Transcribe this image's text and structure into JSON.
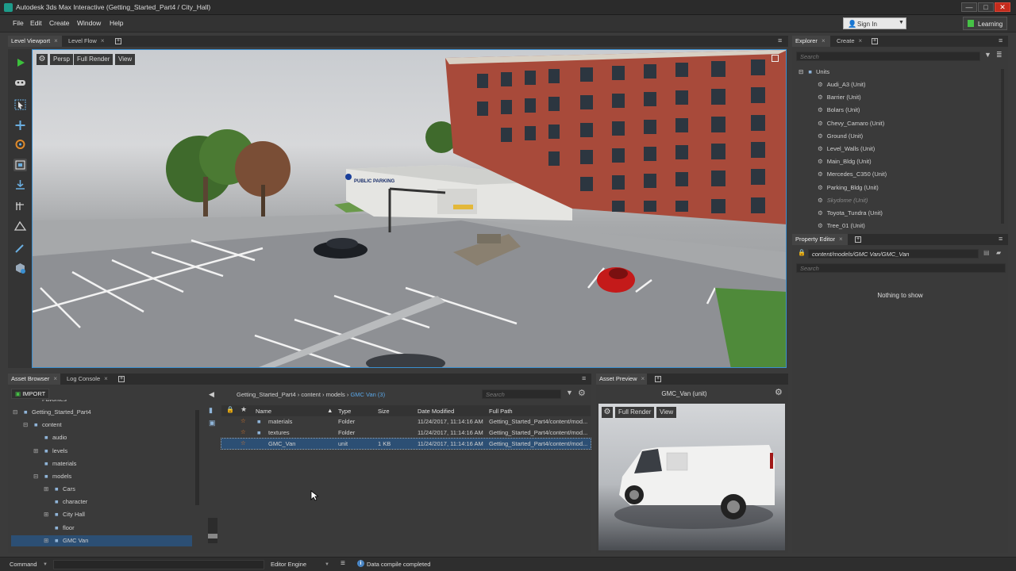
{
  "window": {
    "title": "Autodesk 3ds Max Interactive (Getting_Started_Part4 / City_Hall)",
    "minimize": "—",
    "maximize": "□",
    "close": "✕"
  },
  "menu": [
    "File",
    "Edit",
    "Create",
    "Window",
    "Help"
  ],
  "header": {
    "sign_in": "Sign In",
    "learning": "Learning"
  },
  "viewport_tabs": [
    "Level Viewport",
    "Level Flow"
  ],
  "viewport": {
    "persp": "Persp",
    "full_render": "Full Render",
    "view": "View",
    "sign_text": "PUBLIC PARKING"
  },
  "explorer": {
    "tabs": [
      "Explorer",
      "Create"
    ],
    "search_placeholder": "Search",
    "root": "Units",
    "items": [
      {
        "label": "Audi_A3 (Unit)",
        "dim": false
      },
      {
        "label": "Barrier (Unit)",
        "dim": false
      },
      {
        "label": "Bolars (Unit)",
        "dim": false
      },
      {
        "label": "Chevy_Camaro (Unit)",
        "dim": false
      },
      {
        "label": "Ground (Unit)",
        "dim": false
      },
      {
        "label": "Level_Walls (Unit)",
        "dim": false
      },
      {
        "label": "Main_Bldg (Unit)",
        "dim": false
      },
      {
        "label": "Mercedes_C350 (Unit)",
        "dim": false
      },
      {
        "label": "Parking_Bldg (Unit)",
        "dim": false
      },
      {
        "label": "Skydome (Unit)",
        "dim": true
      },
      {
        "label": "Toyota_Tundra (Unit)",
        "dim": false
      },
      {
        "label": "Tree_01 (Unit)",
        "dim": false
      }
    ]
  },
  "property_editor": {
    "tab": "Property Editor",
    "path": "content/models/GMC Van/GMC_Van",
    "search_placeholder": "Search",
    "empty": "Nothing to show"
  },
  "asset_browser": {
    "tabs": [
      "Asset Browser",
      "Log Console"
    ],
    "import": "IMPORT",
    "tree": [
      {
        "label": "Favorites",
        "indent": 1,
        "expander": "",
        "folder": false,
        "selected": false
      },
      {
        "label": "Getting_Started_Part4",
        "indent": 0,
        "expander": "⊟",
        "folder": true,
        "selected": false
      },
      {
        "label": "content",
        "indent": 1,
        "expander": "⊟",
        "folder": true,
        "selected": false
      },
      {
        "label": "audio",
        "indent": 2,
        "expander": "",
        "folder": true,
        "selected": false
      },
      {
        "label": "levels",
        "indent": 2,
        "expander": "⊞",
        "folder": true,
        "selected": false
      },
      {
        "label": "materials",
        "indent": 2,
        "expander": "",
        "folder": true,
        "selected": false
      },
      {
        "label": "models",
        "indent": 2,
        "expander": "⊟",
        "folder": true,
        "selected": false
      },
      {
        "label": "Cars",
        "indent": 3,
        "expander": "⊞",
        "folder": true,
        "selected": false
      },
      {
        "label": "character",
        "indent": 3,
        "expander": "",
        "folder": true,
        "selected": false
      },
      {
        "label": "City Hall",
        "indent": 3,
        "expander": "⊞",
        "folder": true,
        "selected": false
      },
      {
        "label": "floor",
        "indent": 3,
        "expander": "",
        "folder": true,
        "selected": false
      },
      {
        "label": "GMC Van",
        "indent": 3,
        "expander": "⊞",
        "folder": true,
        "selected": true
      }
    ],
    "breadcrumb": [
      "Getting_Started_Part4",
      "content",
      "models"
    ],
    "breadcrumb_current": "GMC Van (3)",
    "search_placeholder": "Search",
    "columns": {
      "name": "Name",
      "type": "Type",
      "size": "Size",
      "date": "Date Modified",
      "path": "Full Path"
    },
    "rows": [
      {
        "name": "materials",
        "type": "Folder",
        "size": "",
        "date": "11/24/2017, 11:14:16 AM",
        "path": "Getting_Started_Part4/content/mod...",
        "folder": true,
        "selected": false
      },
      {
        "name": "textures",
        "type": "Folder",
        "size": "",
        "date": "11/24/2017, 11:14:16 AM",
        "path": "Getting_Started_Part4/content/mod...",
        "folder": true,
        "selected": false
      },
      {
        "name": "GMC_Van",
        "type": "unit",
        "size": "1 KB",
        "date": "11/24/2017, 11:14:16 AM",
        "path": "Getting_Started_Part4/content/mod...",
        "folder": false,
        "selected": true
      }
    ]
  },
  "asset_preview": {
    "tab": "Asset Preview",
    "title": "GMC_Van (unit)",
    "full_render": "Full Render",
    "view": "View"
  },
  "statusbar": {
    "command": "Command",
    "engine": "Editor Engine",
    "message": "Data compile completed"
  },
  "colors": {
    "accent": "#3a8fd0",
    "play": "#3cc13c",
    "star": "#e07a2a",
    "folder": "#8fb4d8"
  }
}
